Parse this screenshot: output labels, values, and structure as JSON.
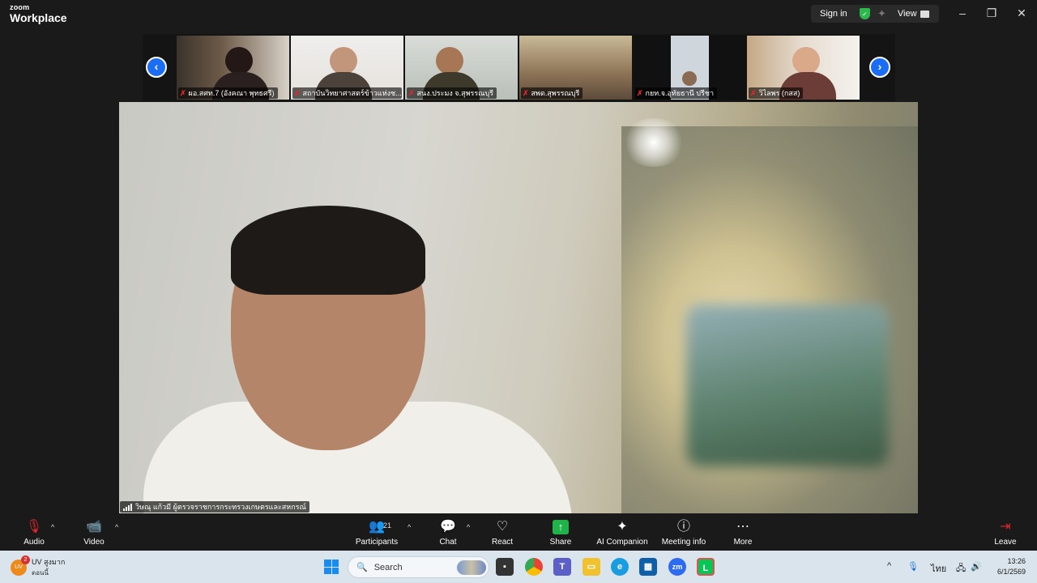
{
  "titlebar": {
    "brand_small": "zoom",
    "brand_big": "Workplace",
    "signin_label": "Sign in",
    "view_label": "View"
  },
  "gallery": {
    "tiles": [
      {
        "name": "ผอ.สศท.7 (อังคณา พุทธศรี)",
        "muted": true
      },
      {
        "name": "สถาบันวิทยาศาสตร์ข้าวแห่งช...",
        "muted": true
      },
      {
        "name": "สนง.ประมง จ.สุพรรณบุรี",
        "muted": true
      },
      {
        "name": "สพด.สุพรรณบุรี",
        "muted": true
      },
      {
        "name": "กยท.จ.อุทัยธานี ปรีชา",
        "muted": true
      },
      {
        "name": "วิไลพร (กสส)",
        "muted": true
      }
    ]
  },
  "main_video": {
    "speaker_label": "วิษณุ แก้วมี ผู้ตรวจราชการกระทรวงเกษตรและสหกรณ์"
  },
  "toolbar": {
    "audio_label": "Audio",
    "video_label": "Video",
    "participants_label": "Participants",
    "participants_count": "21",
    "chat_label": "Chat",
    "react_label": "React",
    "share_label": "Share",
    "ai_label": "AI Companion",
    "info_label": "Meeting info",
    "more_label": "More",
    "leave_label": "Leave"
  },
  "taskbar": {
    "weather_title": "UV สูงมาก",
    "weather_sub": "ตอนนี้",
    "weather_badge": "2",
    "weather_icon_text": "UV",
    "search_placeholder": "Search",
    "lang": "ไทย",
    "time": "13:26",
    "date": "6/1/2569"
  },
  "colors": {
    "accent": "#1b6ef3",
    "share_green": "#1fb34a",
    "mute_red": "#e0262a",
    "background": "#1a1a1a"
  }
}
